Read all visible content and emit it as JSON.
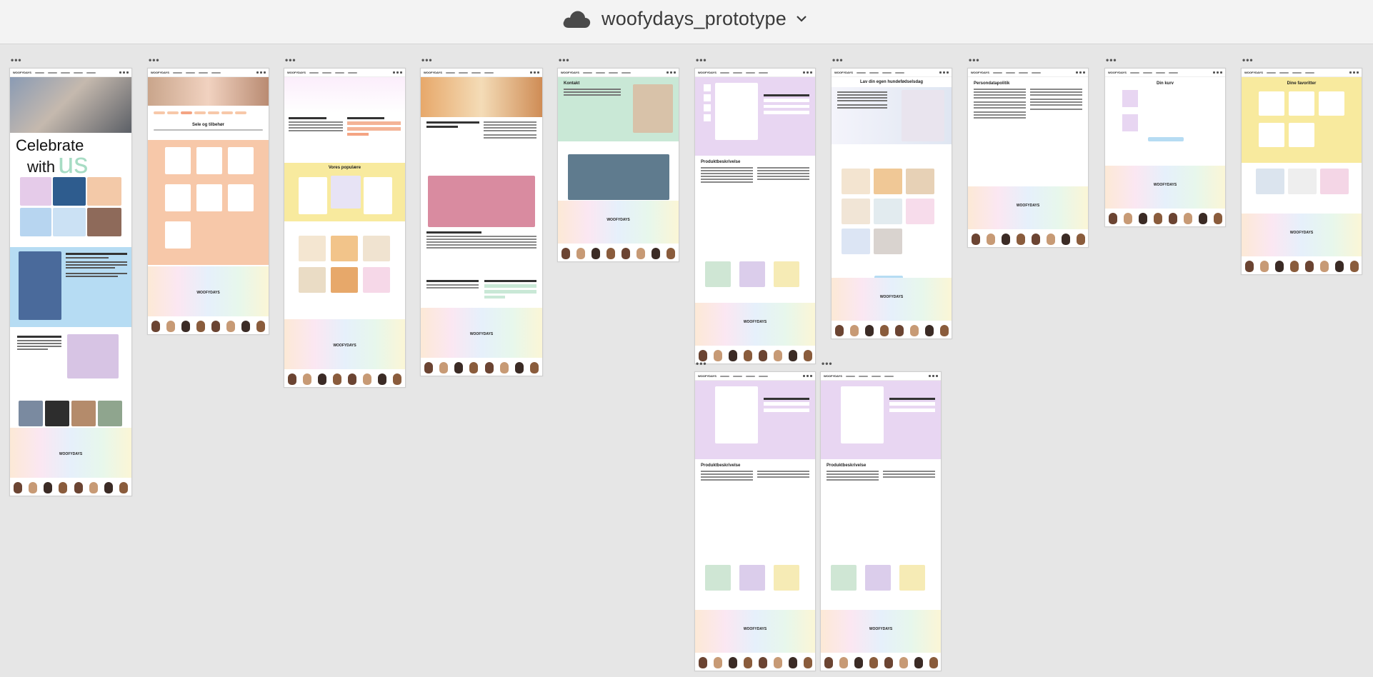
{
  "window": {
    "title": "woofydays_prototype",
    "icons": [
      "cloud-icon",
      "chevron-down-icon"
    ]
  },
  "canvas": {
    "frame_menu_glyph": "•••",
    "logo": "WOOFYDAYS",
    "hero_text_line1": "Celebrate",
    "hero_text_line2": "with",
    "hero_text_accent": "us",
    "frames": [
      {
        "id": "frame-1",
        "heading": "Vi er en dansk hundespil virksomhed"
      },
      {
        "id": "frame-2",
        "heading": "Sele og tilbehør"
      },
      {
        "id": "frame-3",
        "heading": "Vores populære"
      },
      {
        "id": "frame-4",
        "heading": "Vi er en dansk hundespil virksomhed"
      },
      {
        "id": "frame-5",
        "heading": "Kontakt"
      },
      {
        "id": "frame-6",
        "heading": "Produktbeskrivelse"
      },
      {
        "id": "frame-7",
        "heading": "Lav din egen hundefødselsdag"
      },
      {
        "id": "frame-8",
        "heading": "Persondatapolitik"
      },
      {
        "id": "frame-9",
        "heading": "Din kurv"
      },
      {
        "id": "frame-10",
        "heading": "Dine favoritter"
      },
      {
        "id": "frame-11",
        "heading": "Produktbeskrivelse"
      },
      {
        "id": "frame-12",
        "heading": "Produktbeskrivelse"
      }
    ]
  },
  "colors": {
    "pink": "#f3d9ec",
    "peach": "#f7c8a9",
    "yellow": "#f8ea9e",
    "blue": "#b6dcf3",
    "mint": "#c9e8d6",
    "lilac": "#e8d6f2",
    "brown": "#6b4432"
  }
}
